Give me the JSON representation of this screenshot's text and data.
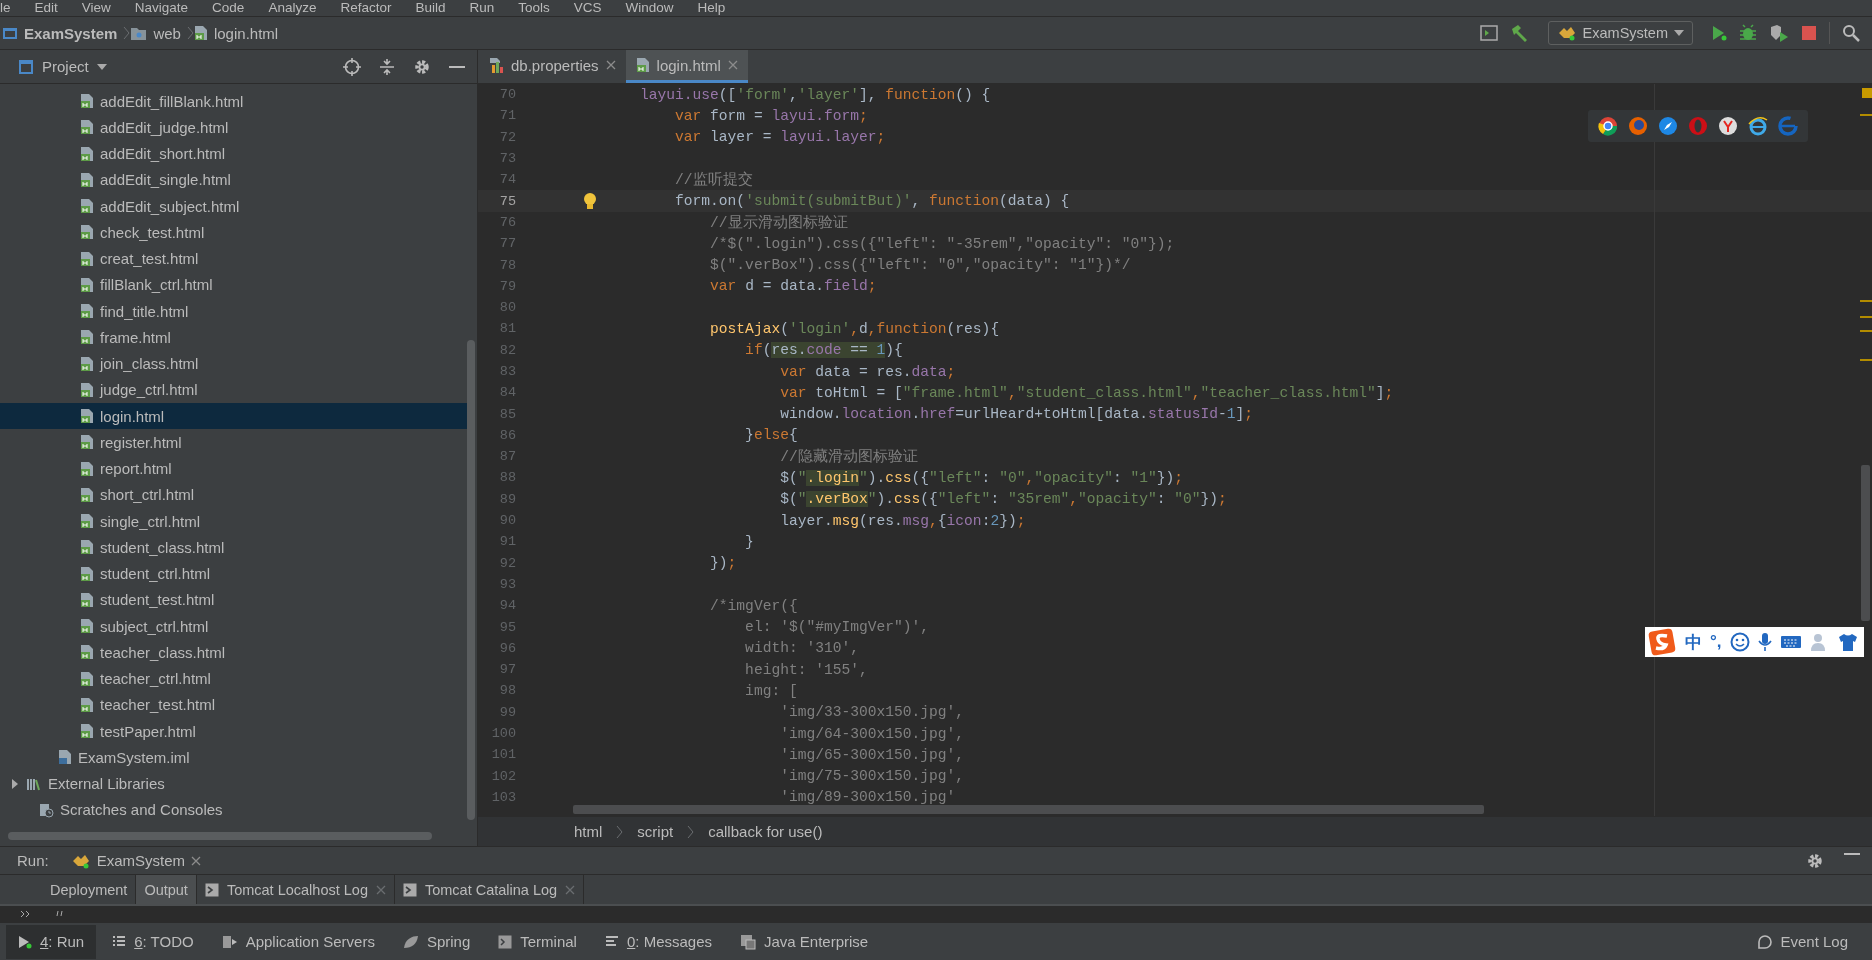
{
  "menu_bar": [
    "le",
    "Edit",
    "View",
    "Navigate",
    "Code",
    "Analyze",
    "Refactor",
    "Build",
    "Run",
    "Tools",
    "VCS",
    "Window",
    "Help"
  ],
  "breadcrumb": [
    {
      "label": "ExamSystem",
      "kind": "project"
    },
    {
      "label": "web",
      "kind": "folder"
    },
    {
      "label": "login.html",
      "kind": "html"
    }
  ],
  "run_config": {
    "label": "ExamSystem"
  },
  "project_panel": {
    "title": "Project",
    "items": [
      {
        "label": "addEdit_fillBlank.html",
        "kind": "html",
        "selected": false
      },
      {
        "label": "addEdit_judge.html",
        "kind": "html",
        "selected": false
      },
      {
        "label": "addEdit_short.html",
        "kind": "html",
        "selected": false
      },
      {
        "label": "addEdit_single.html",
        "kind": "html",
        "selected": false
      },
      {
        "label": "addEdit_subject.html",
        "kind": "html",
        "selected": false
      },
      {
        "label": "check_test.html",
        "kind": "html",
        "selected": false
      },
      {
        "label": "creat_test.html",
        "kind": "html",
        "selected": false
      },
      {
        "label": "fillBlank_ctrl.html",
        "kind": "html",
        "selected": false
      },
      {
        "label": "find_title.html",
        "kind": "html",
        "selected": false
      },
      {
        "label": "frame.html",
        "kind": "html",
        "selected": false
      },
      {
        "label": "join_class.html",
        "kind": "html",
        "selected": false
      },
      {
        "label": "judge_ctrl.html",
        "kind": "html",
        "selected": false
      },
      {
        "label": "login.html",
        "kind": "html",
        "selected": true
      },
      {
        "label": "register.html",
        "kind": "html",
        "selected": false
      },
      {
        "label": "report.html",
        "kind": "html",
        "selected": false
      },
      {
        "label": "short_ctrl.html",
        "kind": "html",
        "selected": false
      },
      {
        "label": "single_ctrl.html",
        "kind": "html",
        "selected": false
      },
      {
        "label": "student_class.html",
        "kind": "html",
        "selected": false
      },
      {
        "label": "student_ctrl.html",
        "kind": "html",
        "selected": false
      },
      {
        "label": "student_test.html",
        "kind": "html",
        "selected": false
      },
      {
        "label": "subject_ctrl.html",
        "kind": "html",
        "selected": false
      },
      {
        "label": "teacher_class.html",
        "kind": "html",
        "selected": false
      },
      {
        "label": "teacher_ctrl.html",
        "kind": "html",
        "selected": false
      },
      {
        "label": "teacher_test.html",
        "kind": "html",
        "selected": false
      },
      {
        "label": "testPaper.html",
        "kind": "html",
        "selected": false
      },
      {
        "label": "ExamSystem.iml",
        "kind": "iml",
        "selected": false
      },
      {
        "label": "External Libraries",
        "kind": "library",
        "selected": false,
        "expanded": false
      },
      {
        "label": "Scratches and Consoles",
        "kind": "scratches",
        "selected": false
      }
    ]
  },
  "editor_tabs": [
    {
      "label": "db.properties",
      "kind": "properties",
      "selected": false
    },
    {
      "label": "login.html",
      "kind": "html",
      "selected": true
    }
  ],
  "code_lines": [
    {
      "n": "70",
      "current": false,
      "tokens": [
        {
          "kind": "property",
          "text": "    layui.use"
        },
        {
          "kind": "plain",
          "text": "(["
        },
        {
          "kind": "string",
          "text": "'form'"
        },
        {
          "kind": "plain",
          "text": ","
        },
        {
          "kind": "string",
          "text": "'layer'"
        },
        {
          "kind": "plain",
          "text": "], "
        },
        {
          "kind": "keyword",
          "text": "function"
        },
        {
          "kind": "plain",
          "text": "() {"
        }
      ]
    },
    {
      "n": "71",
      "current": false,
      "tokens": [
        {
          "kind": "keyword",
          "text": "        var"
        },
        {
          "kind": "plain",
          "text": " form = "
        },
        {
          "kind": "property",
          "text": "layui.form"
        },
        {
          "kind": "keyword",
          "text": ";"
        }
      ]
    },
    {
      "n": "72",
      "current": false,
      "tokens": [
        {
          "kind": "keyword",
          "text": "        var"
        },
        {
          "kind": "plain",
          "text": " layer = "
        },
        {
          "kind": "property",
          "text": "layui.layer"
        },
        {
          "kind": "keyword",
          "text": ";"
        }
      ]
    },
    {
      "n": "73",
      "current": false
    },
    {
      "n": "74",
      "current": false,
      "tokens": [
        {
          "kind": "comment",
          "text": "        //监听提交"
        }
      ]
    },
    {
      "n": "75",
      "current": true,
      "tokens": [
        {
          "kind": "plain",
          "text": "        form.on("
        },
        {
          "kind": "string",
          "text": "'submit(submitBut)'"
        },
        {
          "kind": "plain",
          "text": ", "
        },
        {
          "kind": "keyword",
          "text": "function"
        },
        {
          "kind": "plain",
          "text": "(data) {"
        }
      ]
    },
    {
      "n": "76",
      "current": false,
      "tokens": [
        {
          "kind": "comment",
          "text": "            //显示滑动图标验证"
        }
      ]
    },
    {
      "n": "77",
      "current": false,
      "tokens": [
        {
          "kind": "comment",
          "text": "            /*$(\".login\").css({\"left\": \"-35rem\",\"opacity\": \"0\"});"
        }
      ]
    },
    {
      "n": "78",
      "current": false,
      "tokens": [
        {
          "kind": "comment",
          "text": "            $(\".verBox\").css({\"left\": \"0\",\"opacity\": \"1\"})*/"
        }
      ]
    },
    {
      "n": "79",
      "current": false,
      "tokens": [
        {
          "kind": "keyword",
          "text": "            var"
        },
        {
          "kind": "plain",
          "text": " d = data."
        },
        {
          "kind": "property",
          "text": "field"
        },
        {
          "kind": "keyword",
          "text": ";"
        }
      ]
    },
    {
      "n": "80",
      "current": false
    },
    {
      "n": "81",
      "current": false,
      "tokens": [
        {
          "kind": "function",
          "text": "            postAjax"
        },
        {
          "kind": "plain",
          "text": "("
        },
        {
          "kind": "string",
          "text": "'login'"
        },
        {
          "kind": "keyword",
          "text": ","
        },
        {
          "kind": "plain",
          "text": "d"
        },
        {
          "kind": "keyword",
          "text": ","
        },
        {
          "kind": "keyword",
          "text": "function"
        },
        {
          "kind": "plain",
          "text": "(res){"
        }
      ]
    },
    {
      "n": "82",
      "current": false,
      "tokens": [
        {
          "kind": "keyword",
          "text": "                if"
        },
        {
          "kind": "plain",
          "text": "("
        },
        {
          "kind": "match",
          "text": "res."
        },
        {
          "kind": "matchproperty",
          "text": "code"
        },
        {
          "kind": "match",
          "text": " == "
        },
        {
          "kind": "matchnumber",
          "text": "1"
        },
        {
          "kind": "plain",
          "text": "){"
        }
      ]
    },
    {
      "n": "83",
      "current": false,
      "tokens": [
        {
          "kind": "keyword",
          "text": "                    var"
        },
        {
          "kind": "plain",
          "text": " data = res."
        },
        {
          "kind": "property",
          "text": "data"
        },
        {
          "kind": "keyword",
          "text": ";"
        }
      ]
    },
    {
      "n": "84",
      "current": false,
      "tokens": [
        {
          "kind": "keyword",
          "text": "                    var"
        },
        {
          "kind": "plain",
          "text": " toHtml = ["
        },
        {
          "kind": "string",
          "text": "\"frame.html\""
        },
        {
          "kind": "keyword",
          "text": ","
        },
        {
          "kind": "string",
          "text": "\"student_class.html\""
        },
        {
          "kind": "keyword",
          "text": ","
        },
        {
          "kind": "string",
          "text": "\"teacher_class.html\""
        },
        {
          "kind": "plain",
          "text": "]"
        },
        {
          "kind": "keyword",
          "text": ";"
        }
      ]
    },
    {
      "n": "85",
      "current": false,
      "tokens": [
        {
          "kind": "plain",
          "text": "                    window."
        },
        {
          "kind": "property",
          "text": "location"
        },
        {
          "kind": "plain",
          "text": "."
        },
        {
          "kind": "property",
          "text": "href"
        },
        {
          "kind": "plain",
          "text": "=urlHeard+toHtml[data."
        },
        {
          "kind": "property",
          "text": "statusId"
        },
        {
          "kind": "plain",
          "text": "-"
        },
        {
          "kind": "number",
          "text": "1"
        },
        {
          "kind": "plain",
          "text": "]"
        },
        {
          "kind": "keyword",
          "text": ";"
        }
      ]
    },
    {
      "n": "86",
      "current": false,
      "tokens": [
        {
          "kind": "plain",
          "text": "                }"
        },
        {
          "kind": "keyword",
          "text": "else"
        },
        {
          "kind": "plain",
          "text": "{"
        }
      ]
    },
    {
      "n": "87",
      "current": false,
      "tokens": [
        {
          "kind": "comment",
          "text": "                    //隐藏滑动图标验证"
        }
      ]
    },
    {
      "n": "88",
      "current": false,
      "tokens": [
        {
          "kind": "plain",
          "text": "                    $("
        },
        {
          "kind": "string",
          "text": "\""
        },
        {
          "kind": "matchfunction",
          "text": ".login"
        },
        {
          "kind": "string",
          "text": "\""
        },
        {
          "kind": "plain",
          "text": ")."
        },
        {
          "kind": "function",
          "text": "css"
        },
        {
          "kind": "plain",
          "text": "({"
        },
        {
          "kind": "string",
          "text": "\"left\""
        },
        {
          "kind": "plain",
          "text": ": "
        },
        {
          "kind": "string",
          "text": "\"0\""
        },
        {
          "kind": "keyword",
          "text": ","
        },
        {
          "kind": "string",
          "text": "\"opacity\""
        },
        {
          "kind": "plain",
          "text": ": "
        },
        {
          "kind": "string",
          "text": "\"1\""
        },
        {
          "kind": "plain",
          "text": "})"
        },
        {
          "kind": "keyword",
          "text": ";"
        }
      ]
    },
    {
      "n": "89",
      "current": false,
      "tokens": [
        {
          "kind": "plain",
          "text": "                    $("
        },
        {
          "kind": "string",
          "text": "\""
        },
        {
          "kind": "matchfunction",
          "text": ".verBox"
        },
        {
          "kind": "string",
          "text": "\""
        },
        {
          "kind": "plain",
          "text": ")."
        },
        {
          "kind": "function",
          "text": "css"
        },
        {
          "kind": "plain",
          "text": "({"
        },
        {
          "kind": "string",
          "text": "\"left\""
        },
        {
          "kind": "plain",
          "text": ": "
        },
        {
          "kind": "string",
          "text": "\"35rem\""
        },
        {
          "kind": "keyword",
          "text": ","
        },
        {
          "kind": "string",
          "text": "\"opacity\""
        },
        {
          "kind": "plain",
          "text": ": "
        },
        {
          "kind": "string",
          "text": "\"0\""
        },
        {
          "kind": "plain",
          "text": "})"
        },
        {
          "kind": "keyword",
          "text": ";"
        }
      ]
    },
    {
      "n": "90",
      "current": false,
      "tokens": [
        {
          "kind": "plain",
          "text": "                    layer."
        },
        {
          "kind": "function",
          "text": "msg"
        },
        {
          "kind": "plain",
          "text": "(res."
        },
        {
          "kind": "property",
          "text": "msg"
        },
        {
          "kind": "keyword",
          "text": ","
        },
        {
          "kind": "plain",
          "text": "{"
        },
        {
          "kind": "property",
          "text": "icon"
        },
        {
          "kind": "plain",
          "text": ":"
        },
        {
          "kind": "number",
          "text": "2"
        },
        {
          "kind": "plain",
          "text": "})"
        },
        {
          "kind": "keyword",
          "text": ";"
        }
      ]
    },
    {
      "n": "91",
      "current": false,
      "tokens": [
        {
          "kind": "plain",
          "text": "                }"
        }
      ]
    },
    {
      "n": "92",
      "current": false,
      "tokens": [
        {
          "kind": "plain",
          "text": "            })"
        },
        {
          "kind": "keyword",
          "text": ";"
        }
      ]
    },
    {
      "n": "93",
      "current": false
    },
    {
      "n": "94",
      "current": false,
      "tokens": [
        {
          "kind": "comment",
          "text": "            /*imgVer({"
        }
      ]
    },
    {
      "n": "95",
      "current": false,
      "tokens": [
        {
          "kind": "comment",
          "text": "                el: '$(\"#myImgVer\")',"
        }
      ]
    },
    {
      "n": "96",
      "current": false,
      "tokens": [
        {
          "kind": "comment",
          "text": "                width: '310',"
        }
      ]
    },
    {
      "n": "97",
      "current": false,
      "tokens": [
        {
          "kind": "comment",
          "text": "                height: '155',"
        }
      ]
    },
    {
      "n": "98",
      "current": false,
      "tokens": [
        {
          "kind": "comment",
          "text": "                img: ["
        }
      ]
    },
    {
      "n": "99",
      "current": false,
      "tokens": [
        {
          "kind": "comment",
          "text": "                    'img/33-300x150.jpg',"
        }
      ]
    },
    {
      "n": "100",
      "current": false,
      "tokens": [
        {
          "kind": "comment",
          "text": "                    'img/64-300x150.jpg',"
        }
      ]
    },
    {
      "n": "101",
      "current": false,
      "tokens": [
        {
          "kind": "comment",
          "text": "                    'img/65-300x150.jpg',"
        }
      ]
    },
    {
      "n": "102",
      "current": false,
      "tokens": [
        {
          "kind": "comment",
          "text": "                    'img/75-300x150.jpg',"
        }
      ]
    },
    {
      "n": "103",
      "current": false,
      "tokens": [
        {
          "kind": "comment",
          "text": "                    'img/89-300x150.jpg'"
        }
      ]
    }
  ],
  "structure_path": [
    "html",
    "script",
    "callback for use()"
  ],
  "ime_bar": {
    "mode": "中",
    "punctuation": "°,"
  },
  "run_panel": {
    "label": "Run:",
    "tab": "ExamSystem",
    "subtabs": [
      {
        "label": "Deployment",
        "kind": "plain",
        "selected": false
      },
      {
        "label": "Output",
        "kind": "plain",
        "selected": true
      },
      {
        "label": "Tomcat Localhost Log",
        "kind": "log",
        "selected": false
      },
      {
        "label": "Tomcat Catalina Log",
        "kind": "log",
        "selected": false
      }
    ]
  },
  "tool_windows": [
    {
      "mnemonic": "4",
      "label": ": Run",
      "kind": "run",
      "selected": true
    },
    {
      "mnemonic": "6",
      "label": ": TODO",
      "kind": "todo",
      "selected": false
    },
    {
      "label": "Application Servers",
      "kind": "servers",
      "selected": false
    },
    {
      "label": "Spring",
      "kind": "spring",
      "selected": false
    },
    {
      "label": "Terminal",
      "kind": "terminal",
      "selected": false
    },
    {
      "mnemonic": "0",
      "label": ": Messages",
      "kind": "messages",
      "selected": false
    },
    {
      "label": "Java Enterprise",
      "kind": "enterprise",
      "selected": false
    }
  ],
  "event_log": "Event Log"
}
